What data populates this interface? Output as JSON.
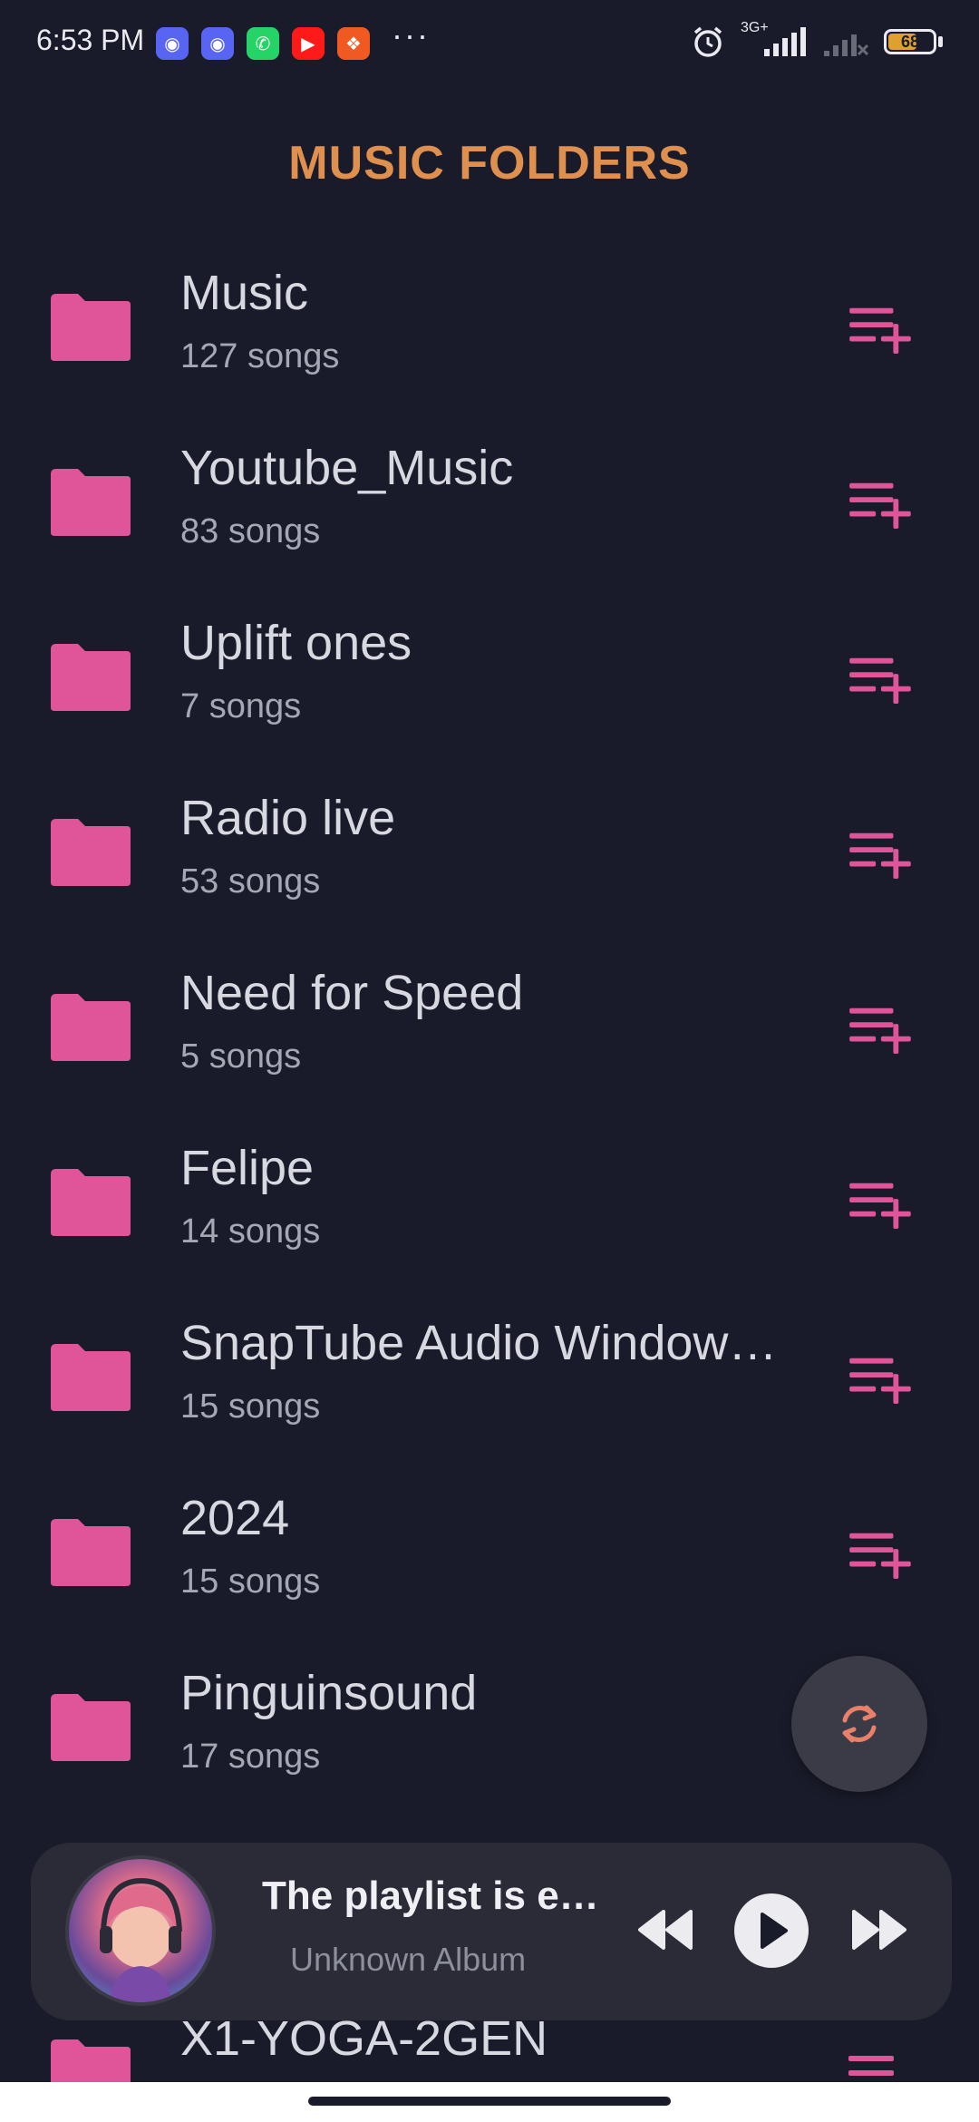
{
  "status_bar": {
    "time": "6:53 PM",
    "apps": [
      "discord-icon",
      "discord-icon",
      "whatsapp-icon",
      "youtube-icon",
      "app-icon"
    ],
    "more": "···",
    "network_label": "3G+",
    "battery_level": "68",
    "battery_fraction": 0.68
  },
  "header": {
    "title": "MUSIC FOLDERS"
  },
  "folders": [
    {
      "name": "Music",
      "count": "127 songs"
    },
    {
      "name": "Youtube_Music",
      "count": "83 songs"
    },
    {
      "name": "Uplift ones",
      "count": "7 songs"
    },
    {
      "name": "Radio live",
      "count": "53 songs"
    },
    {
      "name": "Need for Speed",
      "count": "5 songs"
    },
    {
      "name": "Felipe",
      "count": "14 songs"
    },
    {
      "name": "SnapTube Audio Window…",
      "count": "15 songs"
    },
    {
      "name": "2024",
      "count": "15 songs"
    },
    {
      "name": "Pinguinsound",
      "count": "17 songs"
    }
  ],
  "partial_folder": {
    "name": "X1-YOGA-2GEN"
  },
  "player": {
    "title": "The playlist is e…",
    "album": "Unknown Album"
  },
  "colors": {
    "background": "#1a1b2a",
    "accent_pink": "#e0559a",
    "title_orange": "#e0904e",
    "refresh_orange": "#e8806a"
  }
}
